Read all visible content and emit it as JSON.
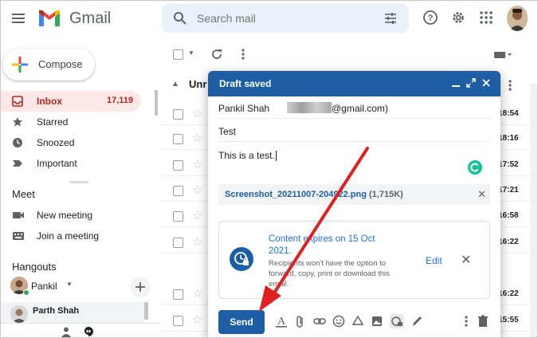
{
  "header": {
    "brand": "Gmail",
    "search_placeholder": "Search mail"
  },
  "sidebar": {
    "compose_label": "Compose",
    "items": [
      {
        "label": "Inbox",
        "count": "17,119"
      },
      {
        "label": "Starred"
      },
      {
        "label": "Snoozed"
      },
      {
        "label": "Important"
      }
    ],
    "meet": {
      "title": "Meet",
      "items": [
        {
          "label": "New meeting"
        },
        {
          "label": "Join a meeting"
        }
      ]
    },
    "hangouts": {
      "title": "Hangouts",
      "user": "Pankil",
      "contact": "Parth Shah"
    }
  },
  "mail_list": {
    "section_label": "Unr",
    "times": [
      "18:54",
      "18:16",
      "17:52",
      "17:21",
      "16:58",
      "16:22",
      "",
      "",
      "16:22",
      "15:55"
    ]
  },
  "compose": {
    "title": "Draft saved",
    "to_name": "Pankil Shah",
    "to_email_suffix": "@gmail.com)",
    "subject": "Test",
    "body": "This is a test.",
    "attachment": {
      "name": "Screenshot_20211007-204922.png",
      "size": "(1,715K)"
    },
    "confidential": {
      "expires": "Content expires on 15 Oct 2021.",
      "description": "Recipients won't have the option to forward, copy, print or download this email.",
      "edit_label": "Edit"
    },
    "send_label": "Send"
  },
  "colors": {
    "compose_header": "#1d5ea5",
    "inbox_active_bg": "#fce8e6",
    "inbox_accent": "#b3261e",
    "annotation_arrow": "#e02020"
  }
}
